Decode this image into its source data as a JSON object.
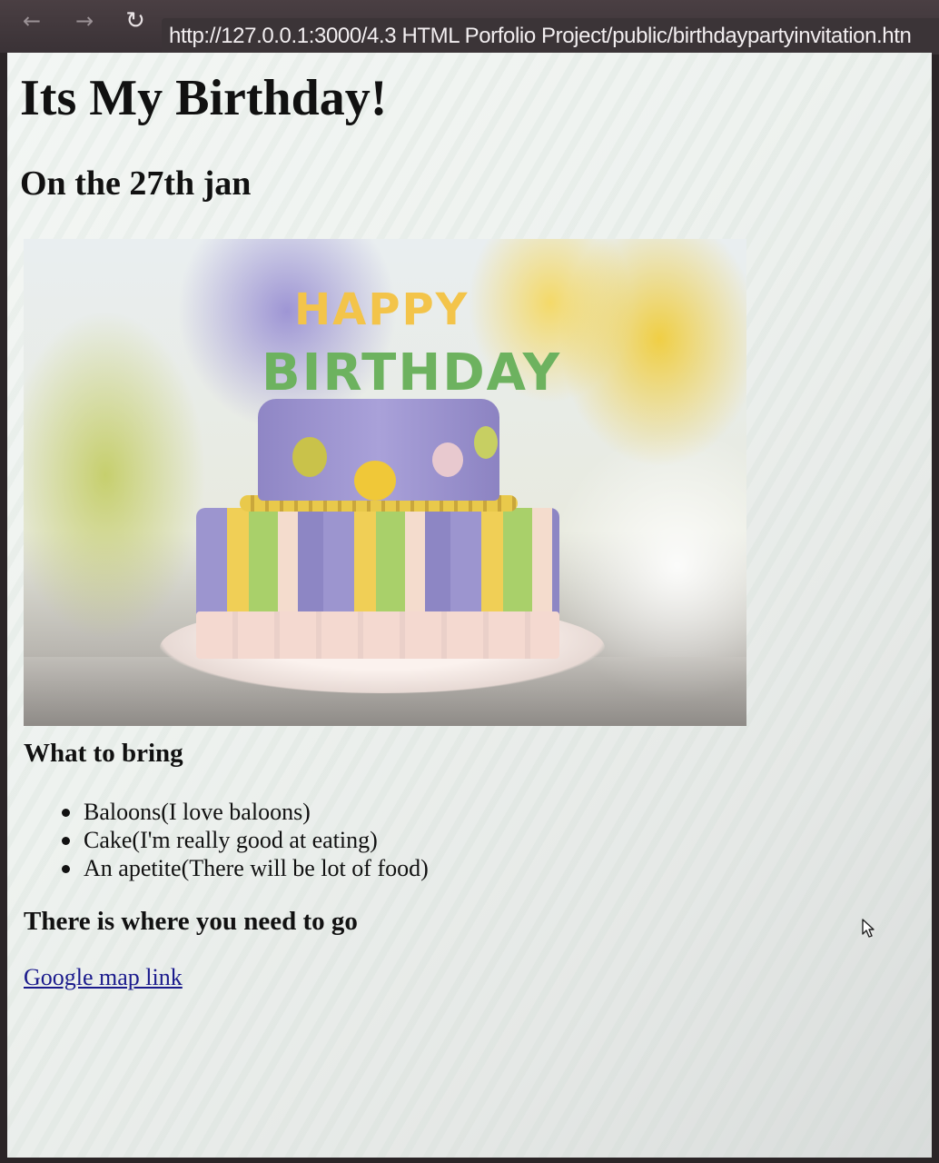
{
  "browser": {
    "back_icon": "←",
    "forward_icon": "→",
    "reload_icon": "↻",
    "url": "http://127.0.0.1:3000/4.3 HTML Porfolio Project/public/birthdaypartyinvitation.htn"
  },
  "page": {
    "title": "Its My Birthday!",
    "subtitle": "On the 27th jan",
    "image": {
      "line1": "HAPPY",
      "line2": "BIRTHDAY"
    },
    "bring_heading": "What to bring",
    "bring_items": [
      "Baloons(I love baloons)",
      "Cake(I'm really good at eating)",
      "An apetite(There will be lot of food)"
    ],
    "location_heading": "There is where you need to go",
    "map_link_text": "Google map link"
  },
  "icons": {
    "back": "arrow-left-icon",
    "forward": "arrow-right-icon",
    "reload": "reload-icon",
    "cursor": "mouse-cursor-icon"
  }
}
